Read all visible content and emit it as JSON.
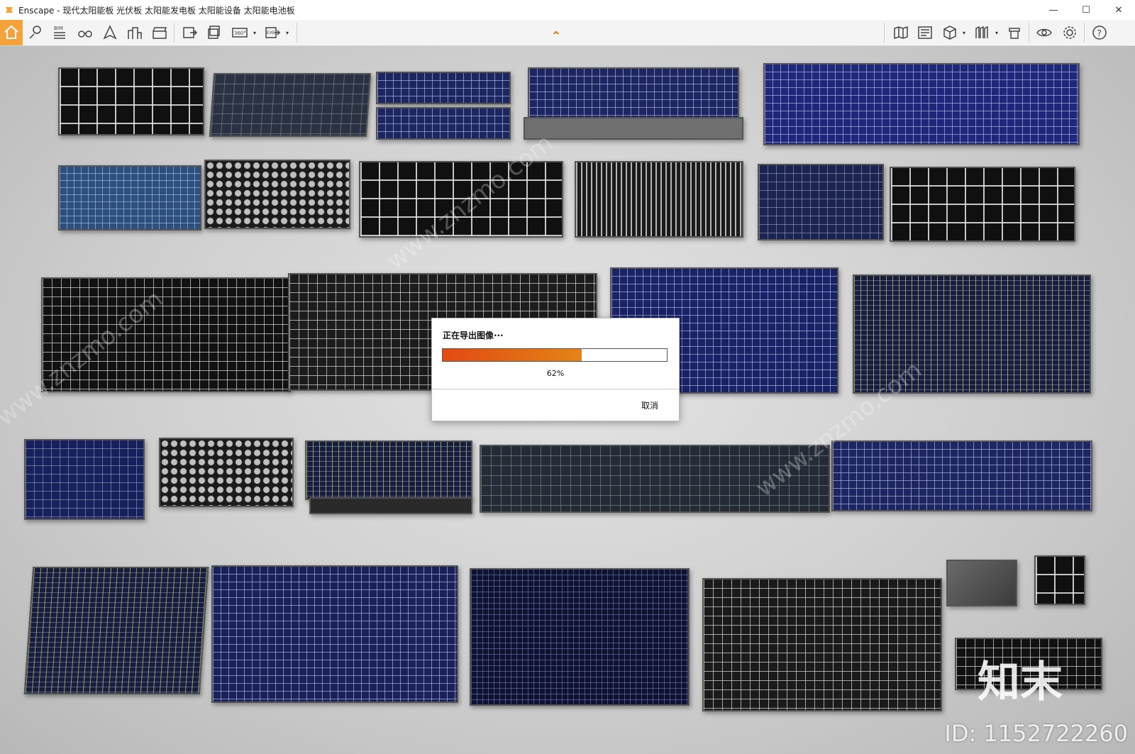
{
  "window": {
    "title": "Enscape - 现代太阳能板 光伏板 太阳能发电板 太阳能设备 太阳能电池板",
    "minimize_glyph": "—",
    "maximize_glyph": "☐",
    "close_glyph": "✕"
  },
  "toolbar": {
    "left_icons": [
      "home-icon",
      "location-pin-icon",
      "bim-info-icon",
      "binoculars-icon",
      "navigation-mode-icon",
      "buildings-icon",
      "clapperboard-icon",
      "export-screenshot-icon",
      "batch-render-icon",
      "panorama-360-icon",
      "export-exe-icon"
    ],
    "bim_label": "BIM",
    "pano_label": "360°",
    "exe_label": "EXE",
    "collapse_glyph": "⌃",
    "right_icons": [
      "map-icon",
      "asset-library-icon",
      "cube-view-icon",
      "sections-icon",
      "material-editor-icon",
      "visibility-icon",
      "settings-icon",
      "help-icon"
    ],
    "help_glyph": "?",
    "accent_color": "#f3a23c"
  },
  "dialog": {
    "title": "正在导出图像···",
    "progress": 0.62,
    "progress_text": "62%",
    "cancel_label": "取消",
    "progress_colors": [
      "#e24a12",
      "#e38416"
    ]
  },
  "watermark": {
    "site": "www.znzmo.com",
    "brand": "知末",
    "id_text": "ID: 1152722260"
  }
}
